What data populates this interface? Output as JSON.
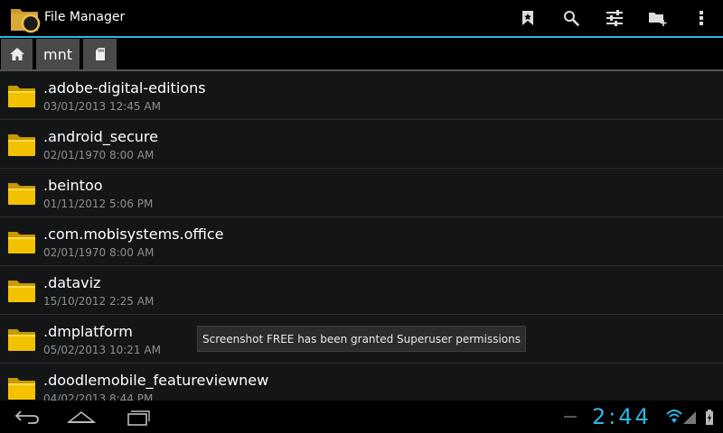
{
  "app": {
    "title": "File Manager"
  },
  "toolbar": {
    "actions": [
      {
        "name": "bookmark-icon"
      },
      {
        "name": "search-icon"
      },
      {
        "name": "settings-sliders-icon"
      },
      {
        "name": "new-folder-icon"
      },
      {
        "name": "overflow-menu-icon"
      }
    ]
  },
  "breadcrumb": {
    "items": [
      {
        "type": "home",
        "icon": "home-icon"
      },
      {
        "type": "text",
        "label": "mnt"
      },
      {
        "type": "icon",
        "icon": "sdcard-icon"
      }
    ]
  },
  "files": [
    {
      "name": ".adobe-digital-editions",
      "date": "03/01/2013 12:45 AM"
    },
    {
      "name": ".android_secure",
      "date": "02/01/1970 8:00 AM"
    },
    {
      "name": ".beintoo",
      "date": "01/11/2012 5:06 PM"
    },
    {
      "name": ".com.mobisystems.office",
      "date": "02/01/1970 8:00 AM"
    },
    {
      "name": ".dataviz",
      "date": "15/10/2012 2:25 AM"
    },
    {
      "name": ".dmplatform",
      "date": "05/02/2013 10:21 AM"
    },
    {
      "name": ".doodlemobile_featureviewnew",
      "date": "04/02/2013 8:44 PM"
    }
  ],
  "toast": {
    "message": "Screenshot FREE has been granted Superuser permissions"
  },
  "system": {
    "clock": "2:44"
  },
  "colors": {
    "accent": "#33b5e5",
    "folder": "#f2c200"
  }
}
